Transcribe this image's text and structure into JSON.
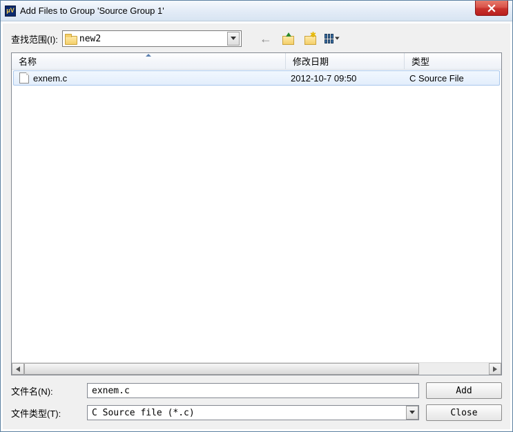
{
  "titlebar": {
    "title": "Add Files to Group 'Source Group 1'"
  },
  "lookin": {
    "label": "查找范围(I):",
    "folder": "new2"
  },
  "columns": {
    "name": "名称",
    "date": "修改日期",
    "type": "类型"
  },
  "files": [
    {
      "name": "exnem.c",
      "date": "2012-10-7 09:50",
      "type": "C Source File"
    }
  ],
  "filename": {
    "label": "文件名(N):",
    "value": "exnem.c"
  },
  "filetype": {
    "label": "文件类型(T):",
    "value": "C Source file (*.c)"
  },
  "buttons": {
    "add": "Add",
    "close": "Close"
  }
}
